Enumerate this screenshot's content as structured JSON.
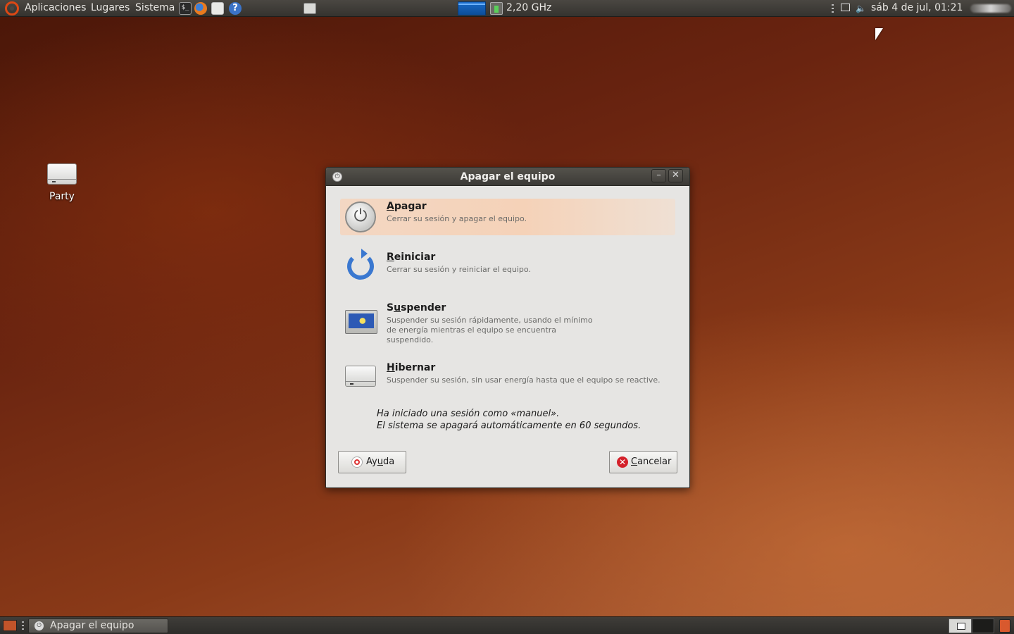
{
  "top_panel": {
    "menus": [
      "Aplicaciones",
      "Lugares",
      "Sistema"
    ],
    "launchers": [
      "terminal-icon",
      "firefox-icon",
      "mail-icon",
      "help-icon"
    ],
    "cpu_freq": "2,20 GHz",
    "clock": "sáb  4 de jul, 01:21"
  },
  "desktop": {
    "icons": [
      {
        "label": "Party",
        "icon": "drive-icon"
      }
    ]
  },
  "dialog": {
    "title": "Apagar el equipo",
    "options": [
      {
        "mnemonic": "A",
        "rest": "pagar",
        "desc": "Cerrar su sesión y apagar el equipo.",
        "icon": "power-icon",
        "selected": true
      },
      {
        "mnemonic": "R",
        "rest": "einiciar",
        "desc": "Cerrar su sesión y reiniciar el equipo.",
        "icon": "restart-icon",
        "selected": false
      },
      {
        "pre": "S",
        "mnemonic": "u",
        "rest": "spender",
        "desc": "Suspender su sesión rápidamente, usando el mínimo\nde energía mientras el equipo se encuentra\nsuspendido.",
        "icon": "suspend-icon",
        "selected": false
      },
      {
        "mnemonic": "H",
        "rest": "ibernar",
        "desc": "Suspender su sesión, sin usar energía hasta que el equipo se reactive.",
        "icon": "hibernate-icon",
        "selected": false
      }
    ],
    "session_line1": "Ha iniciado una sesión como «manuel».",
    "session_line2": "El sistema se apagará automáticamente en 60 segundos.",
    "help_button": {
      "pre": "Ay",
      "mnemonic": "u",
      "rest": "da"
    },
    "cancel_button": {
      "mnemonic": "C",
      "rest": "ancelar"
    }
  },
  "bottom_panel": {
    "task_label": "Apagar el equipo"
  },
  "colors": {
    "accent": "#dd4814",
    "selection": "#f3d7c3"
  }
}
